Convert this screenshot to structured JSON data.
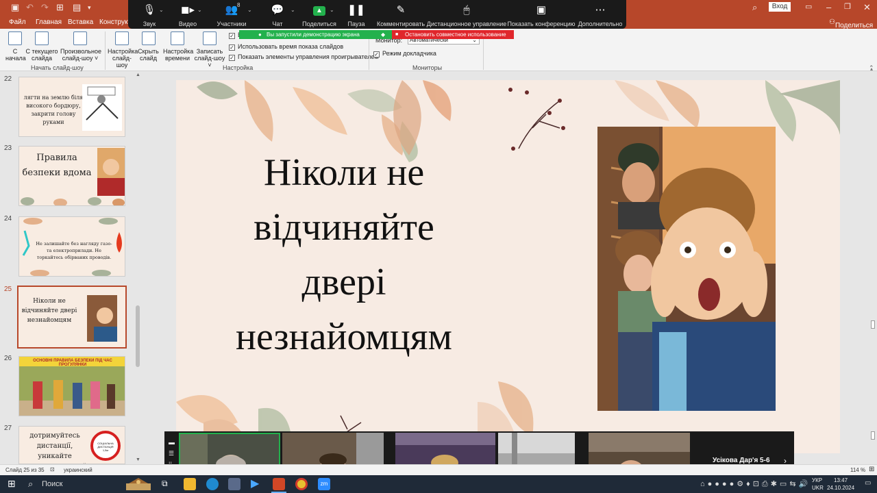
{
  "app": {
    "signin_label": "Вход",
    "share_label": "Поделиться",
    "ribbon_tabs": [
      "Файл",
      "Главная",
      "Вставка",
      "Конструктор"
    ]
  },
  "zoom_toolbar": {
    "items": [
      {
        "label": "Звук",
        "icon": "microphone-icon"
      },
      {
        "label": "Видео",
        "icon": "video-camera-icon"
      },
      {
        "label": "Участники",
        "icon": "participants-icon",
        "badge": "8"
      },
      {
        "label": "Чат",
        "icon": "chat-icon"
      },
      {
        "label": "Поделиться",
        "icon": "share-screen-icon"
      },
      {
        "label": "Пауза",
        "icon": "pause-icon"
      },
      {
        "label": "Комментировать",
        "icon": "annotate-icon"
      },
      {
        "label": "Дистанционное управление",
        "icon": "remote-control-icon"
      },
      {
        "label": "Показать конференцию",
        "icon": "show-meeting-icon"
      },
      {
        "label": "Дополнительно",
        "icon": "more-icon"
      }
    ]
  },
  "share_banner": {
    "status": "Вы запустили демонстрацию экрана",
    "stop_label": "Остановить совместное использование",
    "status_color": "#23b14d",
    "stop_color": "#e0262b"
  },
  "ribbon": {
    "buttons": {
      "from_start": [
        "С",
        "начала"
      ],
      "from_current": [
        "С текущего",
        "слайда"
      ],
      "custom_show": [
        "Произвольное",
        "слайд-шоу ˅"
      ],
      "setup_show": [
        "Настройка",
        "слайд-шоу"
      ],
      "hide_slide": [
        "Скрыть",
        "слайд"
      ],
      "rehearse": [
        "Настройка",
        "времени"
      ],
      "record": [
        "Записать",
        "слайд-шоу ˅"
      ]
    },
    "checkboxes": [
      "В",
      "Использовать время показа слайдов",
      "Показать элементы управления проигрывателем"
    ],
    "monitor_label": "Монитор:",
    "monitor_value": "Автоматически",
    "presenter_view": "Режим докладчика",
    "groups": {
      "start": "Начать слайд-шоу",
      "setup": "Настройка",
      "monitors": "Мониторы"
    }
  },
  "thumbnails": [
    {
      "num": "22",
      "text": "лягти на землю біля високого бордюру, закрити голову руками"
    },
    {
      "num": "23",
      "text": "Правила безпеки вдома"
    },
    {
      "num": "24",
      "text": "Не залишайте без нагляду газо- та електроприлади. Не торкайтесь обірваних проводів."
    },
    {
      "num": "25",
      "text": "Ніколи не відчиняйте двері незнайомцям"
    },
    {
      "num": "26",
      "text": "ОСНОВНІ ПРАВИЛА БЕЗПЕКИ ПІД ЧАС ПРОГУЛЯНКИ"
    },
    {
      "num": "27",
      "text": "дотримуйтесь дистанції, уникайте скупчення людей",
      "sign": "СОЦІАЛЬНА ДИСТАНЦІЯ 1,5м"
    }
  ],
  "active_slide": "25",
  "slide": {
    "title_lines": [
      "Ніколи не",
      "відчиняйте",
      "двері",
      "незнайомцям"
    ],
    "accent_color": "#b7472a"
  },
  "video_strip": {
    "speaker_name": "Усікова Дар'я 5-6"
  },
  "statusbar": {
    "slide_info": "Слайд 25 из 35",
    "language": "украинский",
    "zoom": "114 %"
  },
  "taskbar": {
    "search_placeholder": "Поиск",
    "lang_top": "УКР",
    "lang_bottom": "UKR",
    "time": "13:47",
    "date": "24.10.2024"
  }
}
